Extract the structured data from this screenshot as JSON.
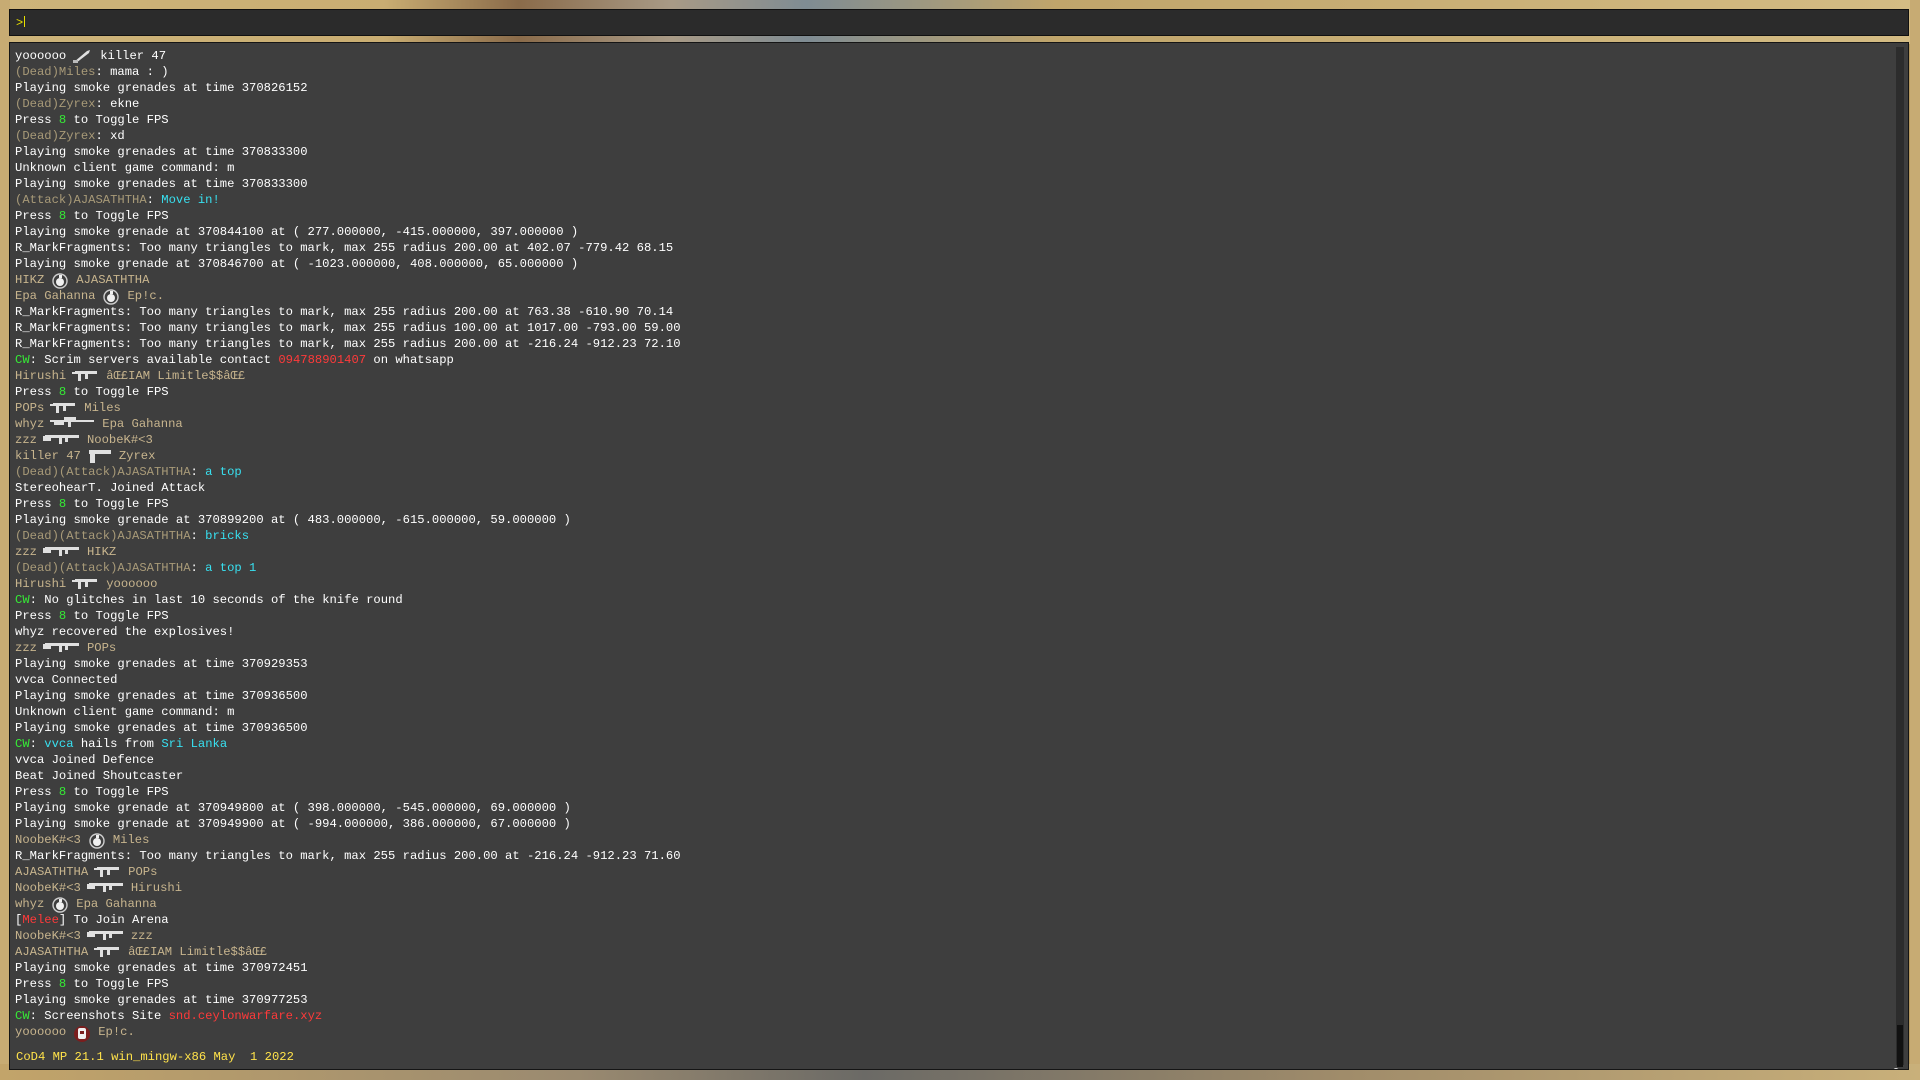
{
  "input": {
    "prompt": ">"
  },
  "log": [
    {
      "type": "kill",
      "killer": "yoooooo",
      "victim": "killer 47",
      "weapon": "knife-icon",
      "killer_color": "#ffffff",
      "victim_color": "#ffffff"
    },
    {
      "type": "chat",
      "prefix": "(Dead)Miles",
      "sep": ": ",
      "msg": "mama : )",
      "msg_class": ""
    },
    {
      "type": "text",
      "text": "Playing smoke grenades at time 370826152"
    },
    {
      "type": "chat",
      "prefix": "(Dead)Zyrex",
      "sep": ": ",
      "msg": "ekne",
      "msg_class": ""
    },
    {
      "type": "fps",
      "a": "Press ",
      "key": "8",
      "b": " to Toggle FPS"
    },
    {
      "type": "chat",
      "prefix": "(Dead)Zyrex",
      "sep": ": ",
      "msg": "xd",
      "msg_class": ""
    },
    {
      "type": "text",
      "text": "Playing smoke grenades at time 370833300"
    },
    {
      "type": "text",
      "text": "Unknown client game command: m"
    },
    {
      "type": "text",
      "text": "Playing smoke grenades at time 370833300"
    },
    {
      "type": "chat",
      "prefix": "(Attack)AJASATHTHA",
      "sep": ": ",
      "msg": "Move in!",
      "msg_class": "c-cyan"
    },
    {
      "type": "fps",
      "a": "Press ",
      "key": "8",
      "b": " to Toggle FPS"
    },
    {
      "type": "text",
      "text": "Playing smoke grenade at 370844100 at ( 277.000000, -415.000000, 397.000000 )"
    },
    {
      "type": "text",
      "text": "R_MarkFragments: Too many triangles to mark, max 255 radius 200.00 at 402.07 -779.42 68.15"
    },
    {
      "type": "text",
      "text": "Playing smoke grenade at 370846700 at ( -1023.000000, 408.000000, 65.000000 )"
    },
    {
      "type": "kill",
      "killer": "HIKZ",
      "victim": "AJASATHTHA",
      "weapon": "grenade-icon",
      "killer_color": "#c8b58e",
      "victim_color": "#c8b58e"
    },
    {
      "type": "kill",
      "killer": "Epa Gahanna",
      "victim": "Ep!c.",
      "weapon": "grenade-icon",
      "killer_color": "#c8b58e",
      "victim_color": "#c8b58e"
    },
    {
      "type": "text",
      "text": "R_MarkFragments: Too many triangles to mark, max 255 radius 200.00 at 763.38 -610.90 70.14"
    },
    {
      "type": "text",
      "text": "R_MarkFragments: Too many triangles to mark, max 255 radius 100.00 at 1017.00 -793.00 59.00"
    },
    {
      "type": "text",
      "text": "R_MarkFragments: Too many triangles to mark, max 255 radius 200.00 at -216.24 -912.23 72.10"
    },
    {
      "type": "cw",
      "tag": "CW",
      "a": ": Scrim servers available contact ",
      "red": "094788901407",
      "b": " on whatsapp"
    },
    {
      "type": "kill",
      "killer": "Hirushi",
      "victim": "âŒ£IAM Limitle$$âŒ£",
      "weapon": "smg-icon",
      "killer_color": "#c8b58e",
      "victim_color": "#c8b58e"
    },
    {
      "type": "fps",
      "a": "Press ",
      "key": "8",
      "b": " to Toggle FPS"
    },
    {
      "type": "kill",
      "killer": "POPs",
      "victim": "Miles",
      "weapon": "smg-icon",
      "killer_color": "#c8b58e",
      "victim_color": "#c8b58e"
    },
    {
      "type": "kill",
      "killer": "whyz",
      "victim": "Epa Gahanna",
      "weapon": "sniper-icon",
      "killer_color": "#c8b58e",
      "victim_color": "#c8b58e"
    },
    {
      "type": "kill",
      "killer": "zzz",
      "victim": "NoobeK#<3",
      "weapon": "rifle-icon",
      "killer_color": "#c8b58e",
      "victim_color": "#c8b58e"
    },
    {
      "type": "kill",
      "killer": "killer 47",
      "victim": "Zyrex",
      "weapon": "pistol-icon",
      "killer_color": "#c8b58e",
      "victim_color": "#c8b58e"
    },
    {
      "type": "chat",
      "prefix": "(Dead)(Attack)AJASATHTHA",
      "sep": ": ",
      "msg": "a top",
      "msg_class": "c-cyan"
    },
    {
      "type": "text",
      "text": "StereohearT. Joined Attack"
    },
    {
      "type": "fps",
      "a": "Press ",
      "key": "8",
      "b": " to Toggle FPS"
    },
    {
      "type": "text",
      "text": "Playing smoke grenade at 370899200 at ( 483.000000, -615.000000, 59.000000 )"
    },
    {
      "type": "chat",
      "prefix": "(Dead)(Attack)AJASATHTHA",
      "sep": ": ",
      "msg": "bricks",
      "msg_class": "c-cyan"
    },
    {
      "type": "kill",
      "killer": "zzz",
      "victim": "HIKZ",
      "weapon": "rifle-icon",
      "killer_color": "#c8b58e",
      "victim_color": "#c8b58e"
    },
    {
      "type": "chat",
      "prefix": "(Dead)(Attack)AJASATHTHA",
      "sep": ": ",
      "msg": "a top 1",
      "msg_class": "c-cyan"
    },
    {
      "type": "kill",
      "killer": "Hirushi",
      "victim": "yoooooo",
      "weapon": "smg-icon",
      "killer_color": "#c8b58e",
      "victim_color": "#c8b58e"
    },
    {
      "type": "cw",
      "tag": "CW",
      "a": ": No glitches in last 10 seconds of the knife round",
      "red": "",
      "b": ""
    },
    {
      "type": "fps",
      "a": "Press ",
      "key": "8",
      "b": " to Toggle FPS"
    },
    {
      "type": "text",
      "text": "whyz recovered the explosives!"
    },
    {
      "type": "kill",
      "killer": "zzz",
      "victim": "POPs",
      "weapon": "rifle-icon",
      "killer_color": "#c8b58e",
      "victim_color": "#c8b58e"
    },
    {
      "type": "text",
      "text": "Playing smoke grenades at time 370929353"
    },
    {
      "type": "text",
      "text": "vvca Connected"
    },
    {
      "type": "text",
      "text": "Playing smoke grenades at time 370936500"
    },
    {
      "type": "text",
      "text": "Unknown client game command: m"
    },
    {
      "type": "text",
      "text": "Playing smoke grenades at time 370936500"
    },
    {
      "type": "cwhail",
      "tag": "CW",
      "sep": ": ",
      "who": "vvca",
      "mid": " hails from ",
      "where": "Sri Lanka"
    },
    {
      "type": "text",
      "text": "vvca Joined Defence"
    },
    {
      "type": "text",
      "text": "Beat Joined Shoutcaster"
    },
    {
      "type": "fps",
      "a": "Press ",
      "key": "8",
      "b": " to Toggle FPS"
    },
    {
      "type": "text",
      "text": "Playing smoke grenade at 370949800 at ( 398.000000, -545.000000, 69.000000 )"
    },
    {
      "type": "text",
      "text": "Playing smoke grenade at 370949900 at ( -994.000000, 386.000000, 67.000000 )"
    },
    {
      "type": "kill",
      "killer": "NoobeK#<3",
      "victim": "Miles",
      "weapon": "grenade-icon",
      "killer_color": "#c8b58e",
      "victim_color": "#c8b58e"
    },
    {
      "type": "text",
      "text": "R_MarkFragments: Too many triangles to mark, max 255 radius 200.00 at -216.24 -912.23 71.60"
    },
    {
      "type": "kill",
      "killer": "AJASATHTHA",
      "victim": "POPs",
      "weapon": "smg-icon",
      "killer_color": "#c8b58e",
      "victim_color": "#c8b58e"
    },
    {
      "type": "kill",
      "killer": "NoobeK#<3",
      "victim": "Hirushi",
      "weapon": "rifle-icon",
      "killer_color": "#c8b58e",
      "victim_color": "#c8b58e"
    },
    {
      "type": "kill",
      "killer": "whyz",
      "victim": "Epa Gahanna",
      "weapon": "grenade-icon",
      "killer_color": "#c8b58e",
      "victim_color": "#c8b58e"
    },
    {
      "type": "melee",
      "lb": "[",
      "red": "Melee",
      "rb": "] To Join Arena"
    },
    {
      "type": "kill",
      "killer": "NoobeK#<3",
      "victim": "zzz",
      "weapon": "rifle-icon",
      "killer_color": "#c8b58e",
      "victim_color": "#c8b58e"
    },
    {
      "type": "kill",
      "killer": "AJASATHTHA",
      "victim": "âŒ£IAM Limitle$$âŒ£",
      "weapon": "smg-icon",
      "killer_color": "#c8b58e",
      "victim_color": "#c8b58e"
    },
    {
      "type": "text",
      "text": "Playing smoke grenades at time 370972451"
    },
    {
      "type": "fps",
      "a": "Press ",
      "key": "8",
      "b": " to Toggle FPS"
    },
    {
      "type": "text",
      "text": "Playing smoke grenades at time 370977253"
    },
    {
      "type": "cw",
      "tag": "CW",
      "a": ": Screenshots Site ",
      "red": "snd.ceylonwarfare.xyz",
      "b": ""
    },
    {
      "type": "kill",
      "killer": "yoooooo",
      "victim": "Ep!c.",
      "weapon": "bomb-icon",
      "killer_color": "#c8b58e",
      "victim_color": "#c8b58e"
    }
  ],
  "version": "CoD4 MP 21.1 win_mingw-x86 May  1 2022",
  "colors": {
    "console_bg": "#3e3e3e",
    "text": "#ffffff",
    "dead": "#a89a78",
    "cyan": "#38e0f0",
    "green": "#36ea36",
    "red": "#ff3a3a",
    "version": "#ffe24a"
  }
}
